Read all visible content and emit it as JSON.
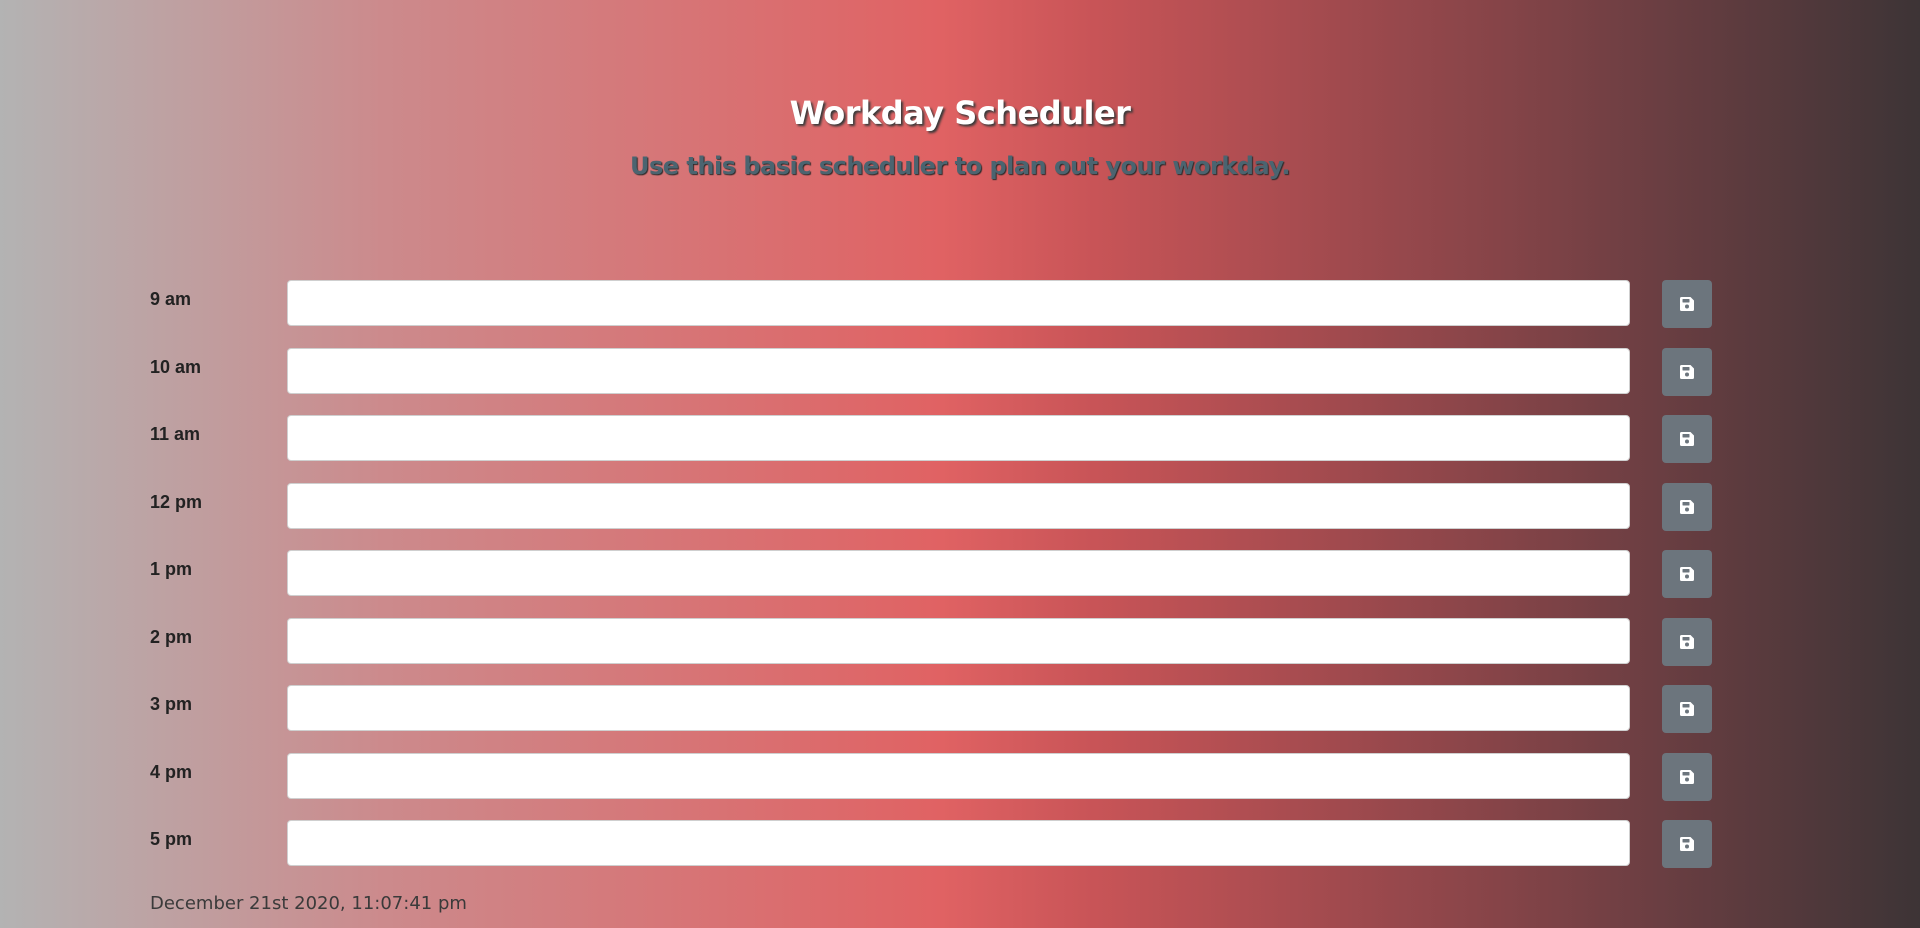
{
  "header": {
    "title": "Workday Scheduler",
    "subtitle": "Use this basic scheduler to plan out your workday."
  },
  "hours": [
    {
      "label": "9 am",
      "value": "",
      "save_icon": "floppy-disk-icon"
    },
    {
      "label": "10 am",
      "value": "",
      "save_icon": "floppy-disk-icon"
    },
    {
      "label": "11 am",
      "value": "",
      "save_icon": "floppy-disk-icon"
    },
    {
      "label": "12 pm",
      "value": "",
      "save_icon": "floppy-disk-icon"
    },
    {
      "label": "1 pm",
      "value": "",
      "save_icon": "floppy-disk-icon"
    },
    {
      "label": "2 pm",
      "value": "",
      "save_icon": "floppy-disk-icon"
    },
    {
      "label": "3 pm",
      "value": "",
      "save_icon": "floppy-disk-icon"
    },
    {
      "label": "4 pm",
      "value": "",
      "save_icon": "floppy-disk-icon"
    },
    {
      "label": "5 pm",
      "value": "",
      "save_icon": "floppy-disk-icon"
    }
  ],
  "footer": {
    "datetime": "December 21st 2020, 11:07:41 pm"
  },
  "colors": {
    "save_button": "#6c757d",
    "title_text": "#ffffff",
    "subtitle_text": "#4b6470",
    "gradient": [
      "#b3b3b3",
      "#e06263",
      "#3d3436"
    ]
  }
}
